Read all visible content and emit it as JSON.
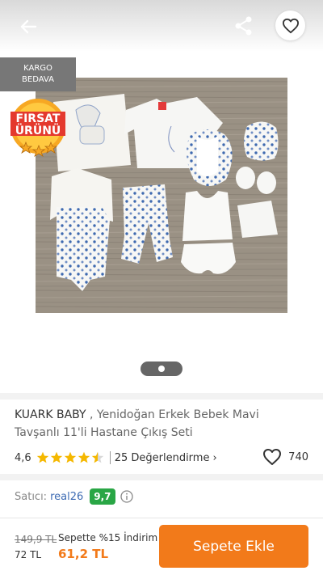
{
  "gallery": {
    "cargo_badge": {
      "line1": "KARGO",
      "line2": "BEDAVA"
    },
    "firsat_badge": {
      "line1": "FIRSAT",
      "line2": "ÜRÜNÜ"
    },
    "image_alt_icon": "baby-clothing-set-photo",
    "pager": {
      "total_dots": 1,
      "active_index": 0
    }
  },
  "product": {
    "brand": "KUARK BABY",
    "name": "Yenidoğan Erkek Bebek Mavi Tavşanlı 11'li Hastane Çıkış Seti",
    "rating": "4,6",
    "stars": 4.5,
    "reviews_label": "25 Değerlendirme",
    "favorite_count": "740"
  },
  "seller": {
    "label": "Satıcı:",
    "name": "real26",
    "score": "9,7"
  },
  "bottom": {
    "old_price": "149,9 TL",
    "base_price": "72 TL",
    "basket_discount": "Sepette %15 İndirim",
    "final_price": "61,2 TL",
    "add_to_cart": "Sepete Ekle"
  },
  "colors": {
    "accent": "#f27a1a",
    "star": "#f5b800",
    "seller_score": "#29a645",
    "seller_link": "#3d6bb3"
  }
}
